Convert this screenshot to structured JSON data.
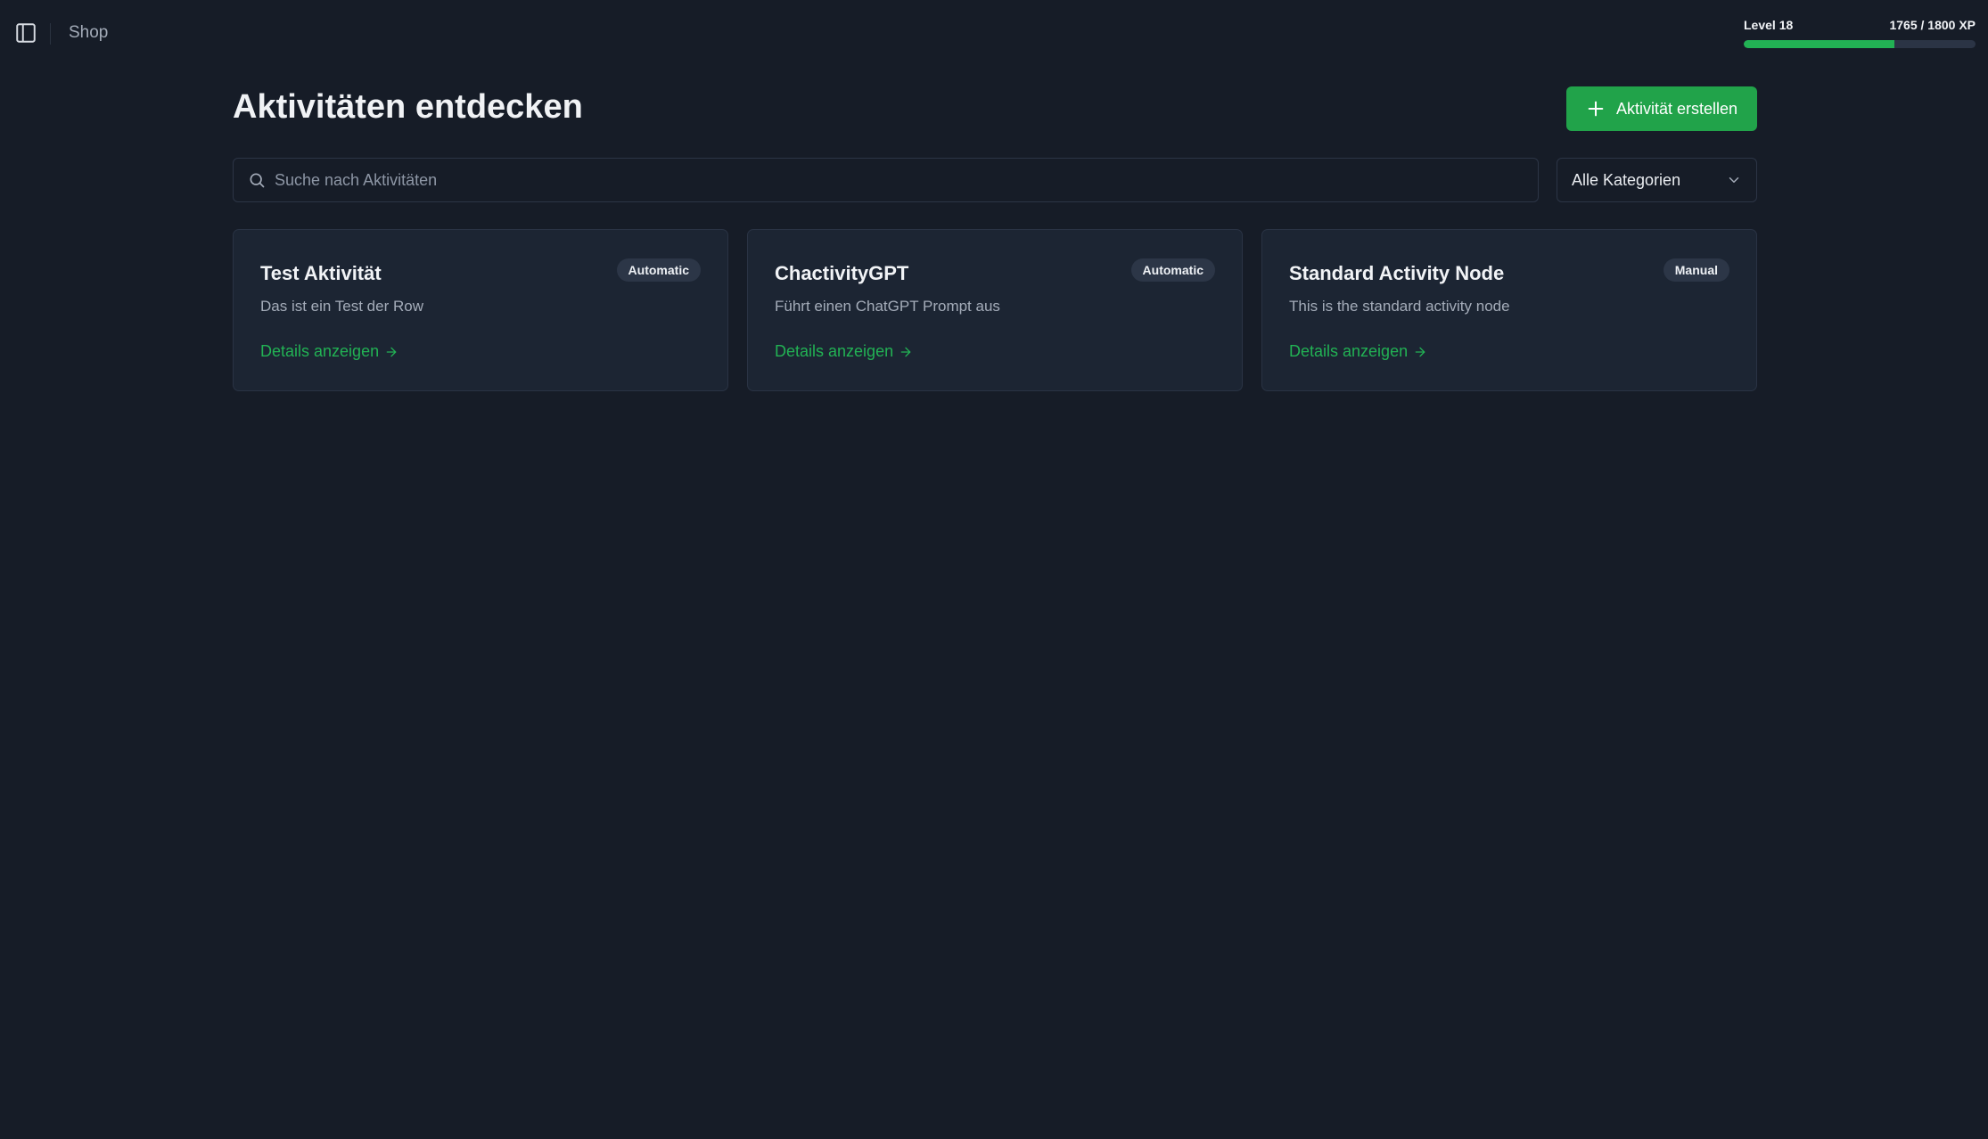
{
  "header": {
    "breadcrumb": "Shop",
    "level_label": "Level 18",
    "xp_label": "1765 / 1800 XP",
    "xp_progress": 0.65,
    "accent_color": "#22b254"
  },
  "main": {
    "title": "Aktivitäten entdecken",
    "create_button_label": "Aktivität erstellen",
    "search_placeholder": "Suche nach Aktivitäten",
    "category_select_value": "Alle Kategorien",
    "cards": [
      {
        "title": "Test Aktivität",
        "description": "Das ist ein Test der Row",
        "badge": "Automatic",
        "link": "Details anzeigen"
      },
      {
        "title": "ChactivityGPT",
        "description": "Führt einen ChatGPT Prompt aus",
        "badge": "Automatic",
        "link": "Details anzeigen"
      },
      {
        "title": "Standard Activity Node",
        "description": "This is the standard activity node",
        "badge": "Manual",
        "link": "Details anzeigen"
      }
    ]
  },
  "icons": {
    "sidebar_toggle": "sidebar-toggle-icon",
    "plus": "plus-icon",
    "search": "search-icon",
    "chevron": "chevron-down-icon",
    "arrow": "arrow-right-icon"
  }
}
